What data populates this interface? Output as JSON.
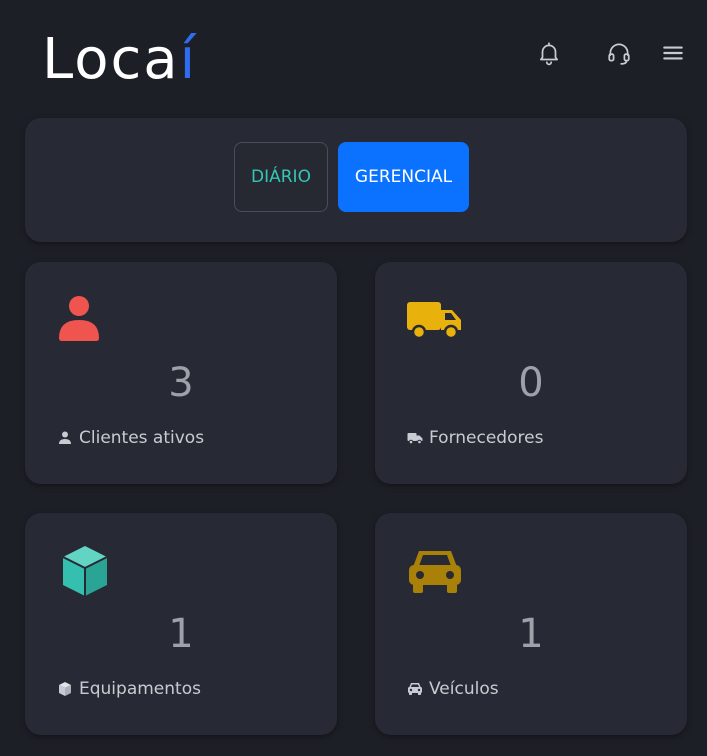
{
  "header": {
    "logo_main": "Loca",
    "logo_accent": "í",
    "icons": [
      "bell-icon",
      "headset-icon",
      "menu-icon"
    ]
  },
  "mode_switch": {
    "diario_label": "DIÁRIO",
    "gerencial_label": "GERENCIAL",
    "selected": "GERENCIAL"
  },
  "cards": [
    {
      "icon": "user-icon",
      "value": "3",
      "label": "Clientes ativos",
      "color": "#f0544f"
    },
    {
      "icon": "truck-icon",
      "value": "0",
      "label": "Fornecedores",
      "color": "#e8b10c"
    },
    {
      "icon": "box-icon",
      "value": "1",
      "label": "Equipamentos",
      "color": "#35bfae"
    },
    {
      "icon": "car-icon",
      "value": "1",
      "label": "Veículos",
      "color": "#a98109"
    }
  ],
  "colors": {
    "background": "#1d1f26",
    "card": "#272a34",
    "primary": "#0a72ff",
    "teal": "#34c6b4",
    "logo_accent": "#2f6cf2"
  }
}
